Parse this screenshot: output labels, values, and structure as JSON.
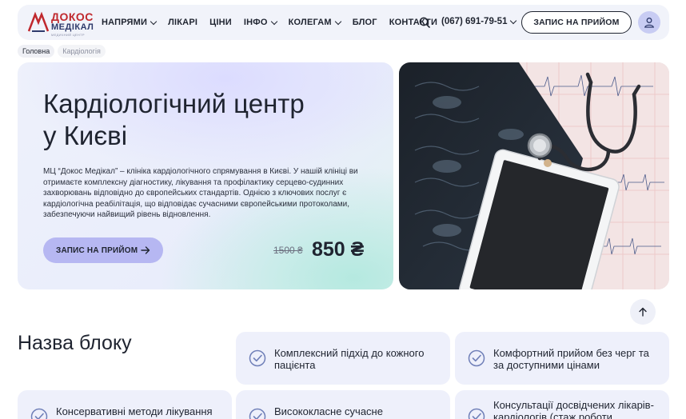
{
  "logo": {
    "line1": "ДОКОС",
    "line2": "МЕДІКАЛ",
    "line3": "МЕДИЧНИЙ ЦЕНТР"
  },
  "nav": [
    {
      "label": "НАПРЯМИ",
      "has_dropdown": true
    },
    {
      "label": "ЛІКАРІ",
      "has_dropdown": false
    },
    {
      "label": "ЦІНИ",
      "has_dropdown": false
    },
    {
      "label": "ІНФО",
      "has_dropdown": true
    },
    {
      "label": "КОЛЕГАМ",
      "has_dropdown": true
    },
    {
      "label": "БЛОГ",
      "has_dropdown": false
    },
    {
      "label": "КОНТАКТИ",
      "has_dropdown": false
    }
  ],
  "header": {
    "search_icon": "search-icon",
    "phone": "(067) 691-79-51",
    "cta": "ЗАПИС НА ПРИЙОМ",
    "avatar_icon": "user-icon"
  },
  "breadcrumb": [
    "Головна",
    "Кардіологія"
  ],
  "hero": {
    "title_line1": "Кардіологічний центр",
    "title_line2": "у Києві",
    "description": "МЦ “Докос Медікал” – клініка кардіологічного спрямування в Києві. У нашій клініці ви отримаєте комплексну діагностику, лікування та профілактику серцево-судинних захворювань відповідно до європейських стандартів. Однією з ключових послуг є кардіологічна реабілітація, що відповідає сучасними європейськими протоколами, забезпечуючи найвищий рівень відновлення.",
    "button": "ЗАПИС НА ПРИЙОМ",
    "old_price": "1500 ₴",
    "new_price": "850 ₴"
  },
  "colors": {
    "accent": "#b6b7f2",
    "card_bg": "#eef0fb",
    "brand_red": "#c0282d",
    "brand_navy": "#2e3a6b"
  },
  "section": {
    "title": "Назва блоку",
    "features": [
      "Комплексний підхід до кожного пацієнта",
      "Комфортний прийом без черг та за доступними цінами",
      "Консервативні методи лікування",
      "Висококласне сучасне обладнання",
      "Консультації досвідчених лікарів-кардіологів (стаж роботи"
    ]
  }
}
